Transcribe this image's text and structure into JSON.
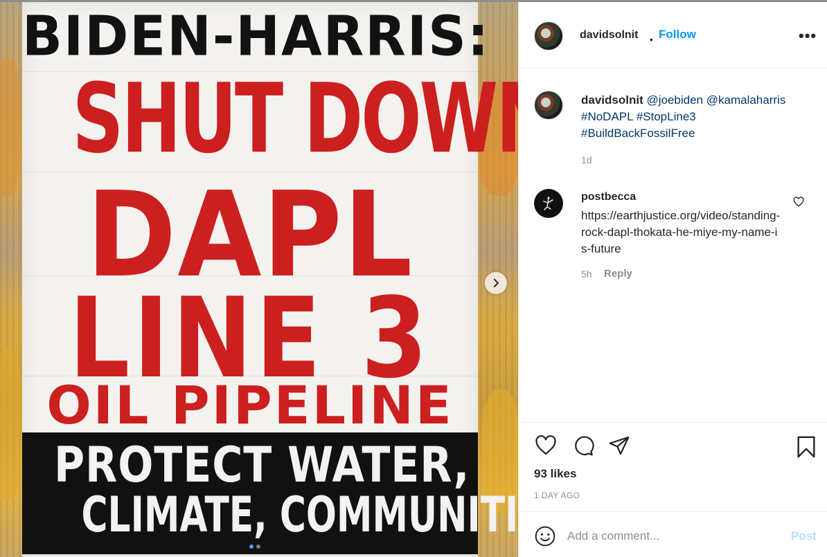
{
  "post_image": {
    "line1": "BIDEN-HARRIS:",
    "line2": "SHUT DOWN",
    "line3": "DAPL",
    "line4": "LINE 3",
    "line5": "OIL PIPELINE",
    "line6": "PROTECT WATER,",
    "line7": "CLIMATE, COMMUNITIES",
    "carousel_count": 2,
    "carousel_active": 1
  },
  "header": {
    "username": "davidsolnit",
    "separator": "•",
    "follow_label": "Follow",
    "more_label": "•••"
  },
  "caption": {
    "username": "davidsolnit",
    "mention1": "@joebiden",
    "mention2": "@kamalaharris",
    "hashtag1": "#NoDAPL",
    "hashtag2": "#StopLine3",
    "hashtag3": "#BuildBackFossilFree",
    "time": "1d"
  },
  "comment": {
    "username": "postbecca",
    "text": "https://earthjustice.org/video/standing-rock-dapl-thokata-he-miye-my-name-is-future",
    "time": "5h",
    "reply_label": "Reply"
  },
  "actions": {
    "likes": "93 likes",
    "posted_ago": "1 DAY AGO"
  },
  "composer": {
    "placeholder": "Add a comment...",
    "post_label": "Post"
  },
  "colors": {
    "accent": "#0095f6",
    "link": "#00376b",
    "banner_red": "#cc1f1f",
    "muted": "#8e8e8e"
  }
}
